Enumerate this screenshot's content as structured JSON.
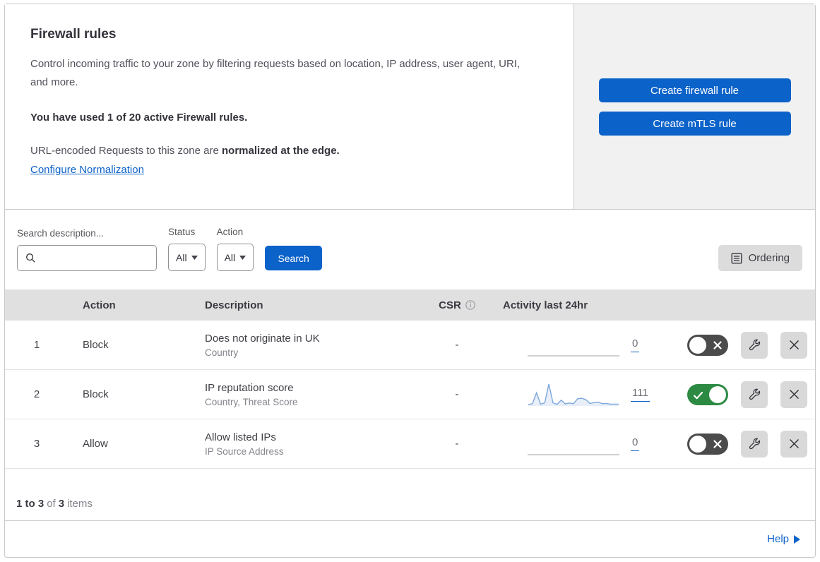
{
  "header": {
    "title": "Firewall rules",
    "description": "Control incoming traffic to your zone by filtering requests based on location, IP address, user agent, URI, and more.",
    "usage": "You have used 1 of 20 active Firewall rules.",
    "normalization_text": "URL-encoded Requests to this zone are ",
    "normalization_bold": "normalized at the edge.",
    "normalization_link": "Configure Normalization",
    "buttons": [
      {
        "label": "Create firewall rule"
      },
      {
        "label": "Create mTLS rule"
      }
    ]
  },
  "filters": {
    "search_label": "Search description...",
    "search_placeholder": "",
    "search_value": "",
    "status_label": "Status",
    "status_value": "All",
    "action_label": "Action",
    "action_value": "All",
    "search_button": "Search",
    "ordering_button": "Ordering"
  },
  "table": {
    "columns": {
      "action": "Action",
      "description": "Description",
      "csr": "CSR",
      "activity": "Activity last 24hr"
    },
    "rows": [
      {
        "priority": "1",
        "action": "Block",
        "description": "Does not originate in UK",
        "fields": "Country",
        "csr": "-",
        "activity_count": "0",
        "enabled": false,
        "has_sparkline": false
      },
      {
        "priority": "2",
        "action": "Block",
        "description": "IP reputation score",
        "fields": "Country, Threat Score",
        "csr": "-",
        "activity_count": "111",
        "enabled": true,
        "has_sparkline": true
      },
      {
        "priority": "3",
        "action": "Allow",
        "description": "Allow listed IPs",
        "fields": "IP Source Address",
        "csr": "-",
        "activity_count": "0",
        "enabled": false,
        "has_sparkline": false
      }
    ]
  },
  "footer": {
    "range": "1 to 3",
    "of_text": "of",
    "total": "3",
    "items_text": "items",
    "help_label": "Help"
  },
  "chart_data": {
    "type": "line",
    "title": "Activity last 24hr sparkline (rule 2, total 111 events)",
    "x": "last 24 hours, evenly spaced samples",
    "values": [
      6,
      10,
      58,
      8,
      14,
      97,
      14,
      7,
      26,
      9,
      13,
      10,
      32,
      34,
      28,
      11,
      15,
      17,
      10,
      11,
      8,
      8,
      8
    ],
    "ylim": [
      0,
      100
    ],
    "line_color": "#7da7dc",
    "fill_color": "rgba(125,167,220,0.18)",
    "flat_line_color": "#b5b5b5"
  },
  "colors": {
    "accent_blue": "#0b62c9",
    "toggle_on_green": "#2c8a43",
    "toggle_off_gray": "#4b4b4b",
    "panel_gray": "#f1f1f1",
    "table_header_gray": "#e0e0e0"
  },
  "icons": {
    "search": "magnifier",
    "dropdown_caret": "triangle-down",
    "ordering": "list-document",
    "csr_info": "info-circle",
    "toggle_on": "check",
    "toggle_off": "cross",
    "edit": "wrench",
    "delete": "x"
  }
}
